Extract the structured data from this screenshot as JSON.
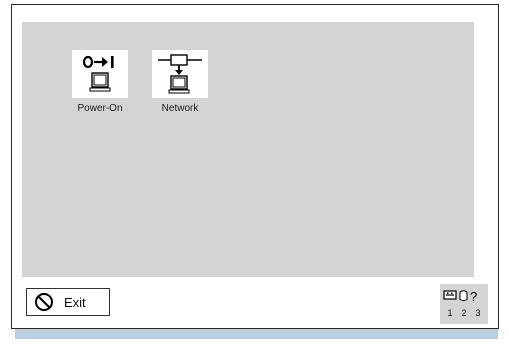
{
  "desktop": {
    "icons": [
      {
        "label": "Power-On",
        "icon": "power-on-icon"
      },
      {
        "label": "Network",
        "icon": "network-icon"
      }
    ]
  },
  "footer": {
    "exit_label": "Exit",
    "exit_icon": "no-entry-icon",
    "status_icons": [
      "keyboard-icon",
      "disk-icon",
      "help-icon"
    ],
    "status_help_glyph": "?",
    "status_numbers": [
      "1",
      "2",
      "3"
    ]
  },
  "colors": {
    "desktop_bg": "#d4d4d4",
    "bottom_strip": "#b8cfe2"
  }
}
